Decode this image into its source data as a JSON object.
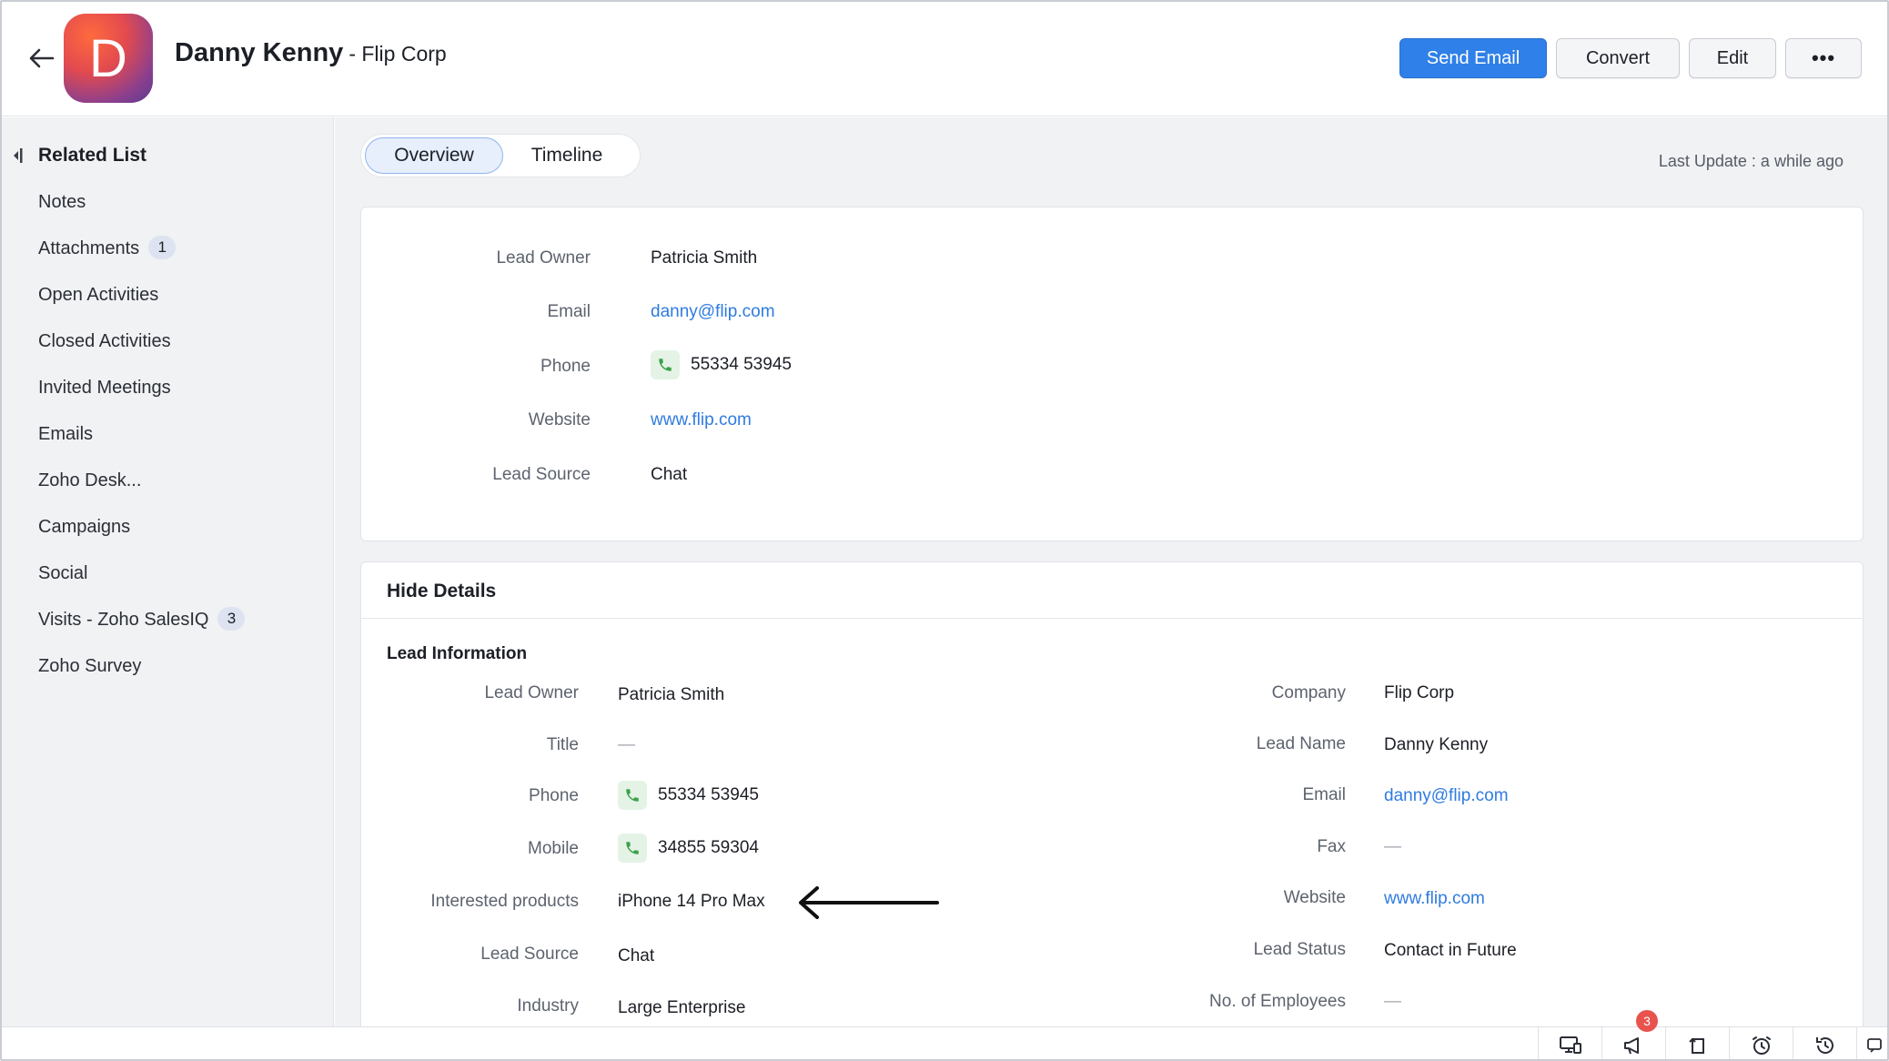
{
  "header": {
    "avatar_letter": "D",
    "lead_name": "Danny Kenny",
    "company_suffix": "- Flip Corp",
    "buttons": {
      "send_email": "Send Email",
      "convert": "Convert",
      "edit": "Edit",
      "more": "•••"
    }
  },
  "sidebar": {
    "title": "Related List",
    "items": [
      {
        "label": "Notes"
      },
      {
        "label": "Attachments",
        "badge": "1"
      },
      {
        "label": "Open Activities"
      },
      {
        "label": "Closed Activities"
      },
      {
        "label": "Invited Meetings"
      },
      {
        "label": "Emails"
      },
      {
        "label": "Zoho Desk..."
      },
      {
        "label": "Campaigns"
      },
      {
        "label": "Social"
      },
      {
        "label": "Visits - Zoho SalesIQ",
        "badge": "3"
      },
      {
        "label": "Zoho Survey"
      }
    ]
  },
  "tabs": {
    "overview": "Overview",
    "timeline": "Timeline"
  },
  "last_update": "Last Update : a while ago",
  "summary": {
    "lead_owner_label": "Lead Owner",
    "lead_owner": "Patricia Smith",
    "email_label": "Email",
    "email": "danny@flip.com",
    "phone_label": "Phone",
    "phone": "55334 53945",
    "website_label": "Website",
    "website": "www.flip.com",
    "lead_source_label": "Lead Source",
    "lead_source": "Chat"
  },
  "details": {
    "hide_details": "Hide Details",
    "section_title": "Lead Information",
    "left": {
      "lead_owner_label": "Lead Owner",
      "lead_owner": "Patricia Smith",
      "title_label": "Title",
      "title": "—",
      "phone_label": "Phone",
      "phone": "55334 53945",
      "mobile_label": "Mobile",
      "mobile": "34855 59304",
      "interested_label": "Interested products",
      "interested": "iPhone 14 Pro Max",
      "lead_source_label": "Lead Source",
      "lead_source": "Chat",
      "industry_label": "Industry",
      "industry": "Large Enterprise"
    },
    "right": {
      "company_label": "Company",
      "company": "Flip Corp",
      "lead_name_label": "Lead Name",
      "lead_name": "Danny Kenny",
      "email_label": "Email",
      "email": "danny@flip.com",
      "fax_label": "Fax",
      "fax": "—",
      "website_label": "Website",
      "website": "www.flip.com",
      "lead_status_label": "Lead Status",
      "lead_status": "Contact in Future",
      "employees_label": "No. of Employees",
      "employees": "—"
    }
  },
  "bottombar": {
    "notification_count": "3"
  },
  "colors": {
    "accent": "#2f80e8",
    "link": "#2f7be0",
    "phone_chip": "#e4f3e6",
    "badge": "#e8534e"
  }
}
